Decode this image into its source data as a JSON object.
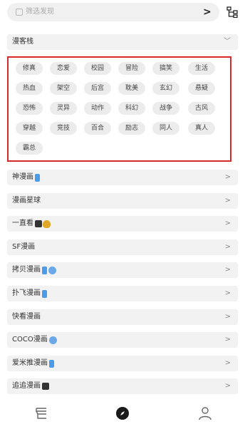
{
  "search": {
    "placeholder": "筛选发现",
    "go_glyph": ">"
  },
  "sections": [
    {
      "label": "漫客栈",
      "chevron": "﹀",
      "badges": []
    }
  ],
  "tags": [
    "修真",
    "恋爱",
    "校园",
    "冒险",
    "搞笑",
    "生活",
    "热血",
    "架空",
    "后宫",
    "耽美",
    "玄幻",
    "悬疑",
    "恐怖",
    "灵异",
    "动作",
    "科幻",
    "战争",
    "古风",
    "穿越",
    "竞技",
    "百合",
    "励志",
    "同人",
    "真人",
    "霸总"
  ],
  "sources": [
    {
      "label": "神漫画",
      "badges": [
        "blue"
      ]
    },
    {
      "label": "漫画星球",
      "badges": []
    },
    {
      "label": "一直看",
      "badges": [
        "dark",
        "gold"
      ]
    },
    {
      "label": "SF漫画",
      "badges": []
    },
    {
      "label": "拷贝漫画",
      "badges": [
        "blue",
        "globe"
      ]
    },
    {
      "label": "扑飞漫画",
      "badges": [
        "blue"
      ]
    },
    {
      "label": "快看漫画",
      "badges": []
    },
    {
      "label": "COCO漫画",
      "badges": [
        "globe"
      ]
    },
    {
      "label": "爱米推漫画",
      "badges": [
        "blue"
      ]
    },
    {
      "label": "追追漫画",
      "badges": [
        "dark"
      ]
    }
  ],
  "row_chevron": ">",
  "nav": [
    "bookshelf",
    "explore",
    "profile"
  ],
  "colors": {
    "highlight_border": "#d42a2a",
    "row_bg": "#f2f2f2",
    "tag_bg": "#ececec"
  }
}
